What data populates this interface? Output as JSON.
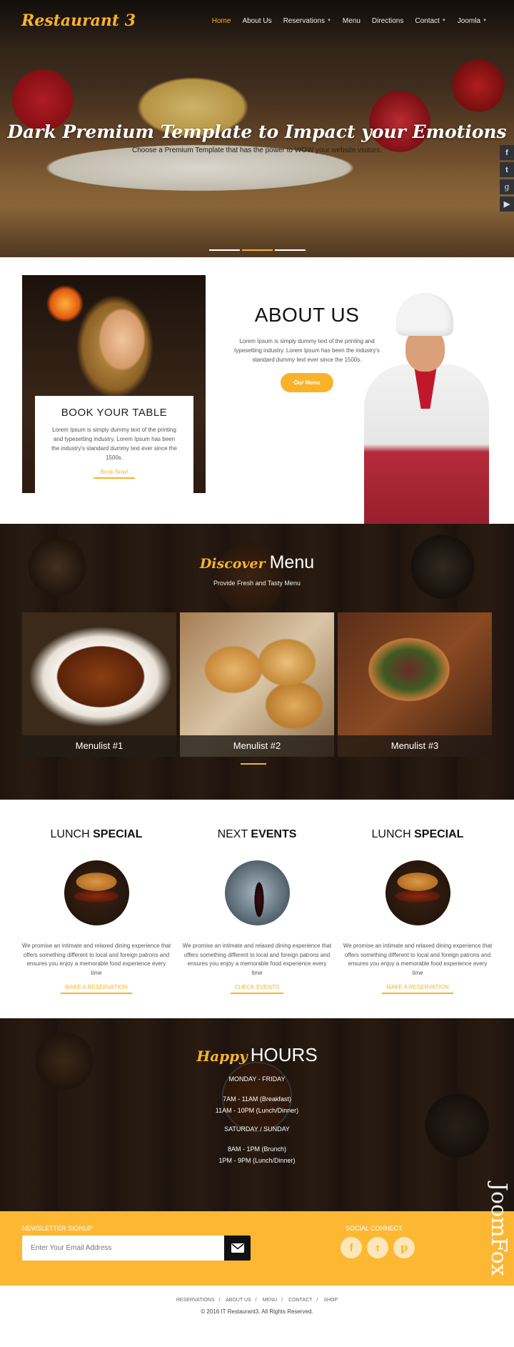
{
  "header": {
    "logo": "Restaurant 3",
    "nav": [
      {
        "label": "Home",
        "active": true,
        "dropdown": false
      },
      {
        "label": "About Us",
        "active": false,
        "dropdown": false
      },
      {
        "label": "Reservations",
        "active": false,
        "dropdown": true
      },
      {
        "label": "Menu",
        "active": false,
        "dropdown": false
      },
      {
        "label": "Directions",
        "active": false,
        "dropdown": false
      },
      {
        "label": "Contact",
        "active": false,
        "dropdown": true
      },
      {
        "label": "Joomla",
        "active": false,
        "dropdown": true
      }
    ]
  },
  "hero": {
    "title": "Dark Premium Template to Impact your Emotions",
    "subtitle": "Choose a Premium Template that has the power to WOW your website visitors.",
    "slides": 3,
    "active_slide": 2
  },
  "side_social": [
    "facebook-icon",
    "twitter-icon",
    "google-icon",
    "youtube-icon"
  ],
  "book": {
    "title": "BOOK YOUR TABLE",
    "text": "Lorem Ipsum is simply dummy text of the printing and typesetting industry. Lorem Ipsum has been the industry's standard dummy text ever since the 1500s.",
    "button": "Book Now!"
  },
  "about": {
    "title": "ABOUT US",
    "text": "Lorem Ipsum is simply dummy text of the printing and typesetting industry. Lorem Ipsum has been the industry's standard dummy text ever since the 1500s.",
    "button": "Our Menu"
  },
  "menu": {
    "script": "Discover",
    "title": "Menu",
    "subtitle": "Provide Fresh and Tasty Menu",
    "items": [
      {
        "label": "Menulist #1"
      },
      {
        "label": "Menulist #2"
      },
      {
        "label": "Menulist #3"
      }
    ]
  },
  "specials": [
    {
      "title_light": "LUNCH",
      "title_bold": "SPECIAL",
      "text": "We promise an intimate and relaxed dining experience that offers something different to local and foreign patrons and ensures you enjoy a memorable food experience every time",
      "link": "MAKE A RESERVATION"
    },
    {
      "title_light": "NEXT",
      "title_bold": "EVENTS",
      "text": "We promise an intimate and relaxed dining experience that offers something different to local and foreign patrons and ensures you enjoy a memorable food experience every time",
      "link": "CHECK EVENTS"
    },
    {
      "title_light": "LUNCH",
      "title_bold": "SPECIAL",
      "text": "We promise an intimate and relaxed dining experience that offers something different to local and foreign patrons and ensures you enjoy a memorable food experience every time",
      "link": "MAKE A RESERVATION"
    }
  ],
  "hours": {
    "script": "Happy",
    "title": "HOURS",
    "weekday_label": "MONDAY - FRIDAY",
    "weekday": [
      "7AM - 11AM (Breakfast)",
      "11AM - 10PM (Lunch/Dinner)"
    ],
    "weekend_label": "SATURDAY / SUNDAY",
    "weekend": [
      "8AM - 1PM (Brunch)",
      "1PM - 9PM (Lunch/Dinner)"
    ]
  },
  "newsletter": {
    "label": "NEWSLETTER SIGNUP",
    "placeholder": "Enter Your Email Address",
    "value": ""
  },
  "social": {
    "label": "SOCIAL CONNECT",
    "icons": [
      "facebook-icon",
      "twitter-icon",
      "pinterest-icon"
    ]
  },
  "watermark": "JoomFox",
  "footer": {
    "links": [
      "RESERVATIONS",
      "ABOUT US",
      "MENU",
      "CONTACT",
      "SHOP"
    ],
    "copyright": "© 2016 IT Restaurant3. All Rights Reserved."
  },
  "colors": {
    "accent": "#f8b32b",
    "newsletter_bg": "#fdb733",
    "dark": "#111111"
  }
}
